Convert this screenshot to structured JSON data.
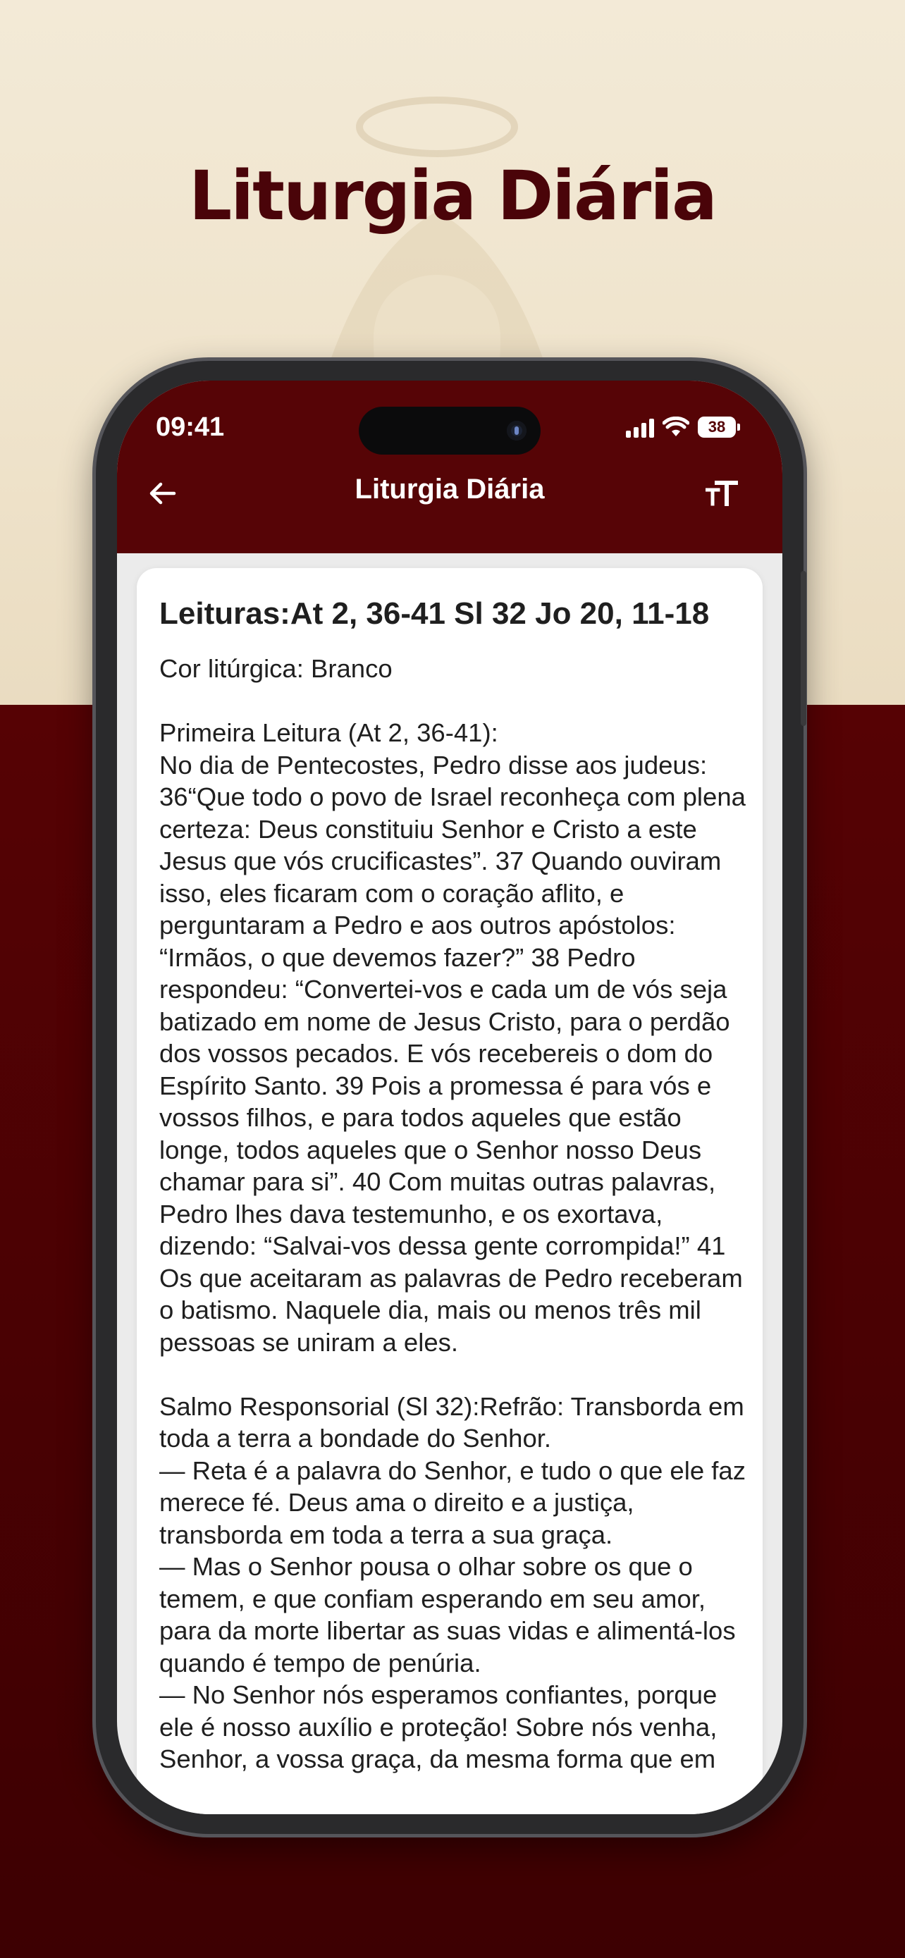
{
  "promo": {
    "title": "Liturgia Diária"
  },
  "status_bar": {
    "time": "09:41",
    "battery": "38"
  },
  "app_bar": {
    "title": "Liturgia Diária",
    "back_icon": "arrow-left-icon",
    "font_size_icon": "text-size-icon"
  },
  "reading": {
    "heading": "Leituras:At 2, 36-41 Sl 32 Jo 20, 11-18",
    "body": "Cor litúrgica: Branco\n\nPrimeira Leitura (At 2, 36-41):\nNo dia de Pentecostes, Pedro disse aos judeus:\n36“Que todo o povo de Israel reconheça com plena certeza: Deus constituiu Senhor e Cristo a este Jesus que vós crucificastes”. 37 Quando ouviram isso, eles ficaram com o coração aflito, e perguntaram a Pedro e aos outros apóstolos: “Irmãos, o que devemos fazer?” 38 Pedro respondeu: “Convertei-vos e cada um de vós seja batizado em nome de Jesus Cristo, para o perdão dos vossos pecados. E vós recebereis o dom do Espírito Santo. 39 Pois a promessa é para vós e vossos filhos, e para todos aqueles que estão longe, todos aqueles que o Senhor nosso Deus chamar para si”. 40 Com muitas outras palavras, Pedro lhes dava testemunho, e os exortava, dizendo: “Salvai-vos dessa gente corrompida!” 41 Os que aceitaram as palavras de Pedro receberam o batismo. Naquele dia, mais ou menos três mil pessoas se uniram a eles.\n\nSalmo Responsorial (Sl 32):Refrão: Transborda em toda a terra a bondade do Senhor.\n— Reta é a palavra do Senhor, e tudo o que ele faz merece fé. Deus ama o direito e a justiça, transborda em toda a terra a sua graça.\n— Mas o Senhor pousa o olhar sobre os que o temem, e que confiam esperando em seu amor, para da morte libertar as suas vidas e alimentá-los quando é tempo de penúria.\n— No Senhor nós esperamos confiantes, porque ele é nosso auxílio e proteção! Sobre nós venha, Senhor, a vossa graça, da mesma forma que em"
  },
  "colors": {
    "brand": "#560406",
    "title": "#4a0409",
    "background_top": "#f3ead7",
    "background_bottom": "#4e0204"
  }
}
